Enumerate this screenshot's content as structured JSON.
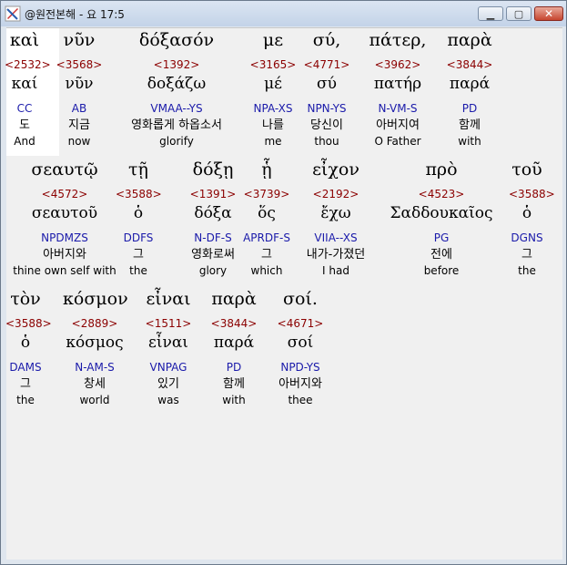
{
  "window": {
    "title": "@원전본해 - 요 17:5",
    "icon": "bible-app-icon",
    "controls": {
      "minimize": "minimize-icon",
      "maximize": "maximize-icon",
      "close": "close-icon"
    }
  },
  "rows": [
    {
      "words": [
        {
          "greek": "καὶ",
          "strong": "<2532>",
          "lemma": "καί",
          "parse": "CC",
          "korean": "도",
          "english": "And"
        },
        {
          "greek": "νῦν",
          "strong": "<3568>",
          "lemma": "νῦν",
          "parse": "AB",
          "korean": "지금",
          "english": "now"
        },
        {
          "greek": "δόξασόν",
          "strong": "<1392>",
          "lemma": "δοξάζω",
          "parse": "VMAA--YS",
          "korean": "영화롭게 하옵소서",
          "english": "glorify"
        },
        {
          "greek": "με",
          "strong": "<3165>",
          "lemma": "μέ",
          "parse": "NPA-XS",
          "korean": "나를",
          "english": "me"
        },
        {
          "greek": "σύ,",
          "strong": "<4771>",
          "lemma": "σύ",
          "parse": "NPN-YS",
          "korean": "당신이",
          "english": "thou"
        },
        {
          "greek": "πάτερ,",
          "strong": "<3962>",
          "lemma": "πατήρ",
          "parse": "N-VM-S",
          "korean": "아버지여",
          "english": "O Father"
        },
        {
          "greek": "παρὰ",
          "strong": "<3844>",
          "lemma": "παρά",
          "parse": "PD",
          "korean": "함께",
          "english": "with"
        }
      ]
    },
    {
      "words": [
        {
          "greek": "σεαυτῷ",
          "strong": "<4572>",
          "lemma": "σεαυτοῦ",
          "parse": "NPDMZS",
          "korean": "아버지와",
          "english": "thine own self with"
        },
        {
          "greek": "τῇ",
          "strong": "<3588>",
          "lemma": "ὁ",
          "parse": "DDFS",
          "korean": "그",
          "english": "the"
        },
        {
          "greek": "δόξῃ",
          "strong": "<1391>",
          "lemma": "δόξα",
          "parse": "N-DF-S",
          "korean": "영화로써",
          "english": "glory"
        },
        {
          "greek": "ᾗ",
          "strong": "<3739>",
          "lemma": "ὅς",
          "parse": "APRDF-S",
          "korean": "그",
          "english": "which"
        },
        {
          "greek": "εἶχον",
          "strong": "<2192>",
          "lemma": "ἔχω",
          "parse": "VIIA--XS",
          "korean": "내가-가졌던",
          "english": "I had"
        },
        {
          "greek": "πρὸ",
          "strong": "<4523>",
          "lemma": "Σαδδουκαῖος",
          "parse": "PG",
          "korean": "전에",
          "english": "before"
        },
        {
          "greek": "τοῦ",
          "strong": "<3588>",
          "lemma": "ὁ",
          "parse": "DGNS",
          "korean": "그",
          "english": "the"
        }
      ]
    },
    {
      "words": [
        {
          "greek": "τὸν",
          "strong": "<3588>",
          "lemma": "ὁ",
          "parse": "DAMS",
          "korean": "그",
          "english": "the"
        },
        {
          "greek": "κόσμον",
          "strong": "<2889>",
          "lemma": "κόσμος",
          "parse": "N-AM-S",
          "korean": "창세",
          "english": "world"
        },
        {
          "greek": "εἶναι",
          "strong": "<1511>",
          "lemma": "εἶναι",
          "parse": "VNPAG",
          "korean": "있기",
          "english": "was"
        },
        {
          "greek": "παρὰ",
          "strong": "<3844>",
          "lemma": "παρά",
          "parse": "PD",
          "korean": "함께",
          "english": "with"
        },
        {
          "greek": "σοί.",
          "strong": "<4671>",
          "lemma": "σοί",
          "parse": "NPD-YS",
          "korean": "아버지와",
          "english": "thee"
        }
      ]
    }
  ]
}
